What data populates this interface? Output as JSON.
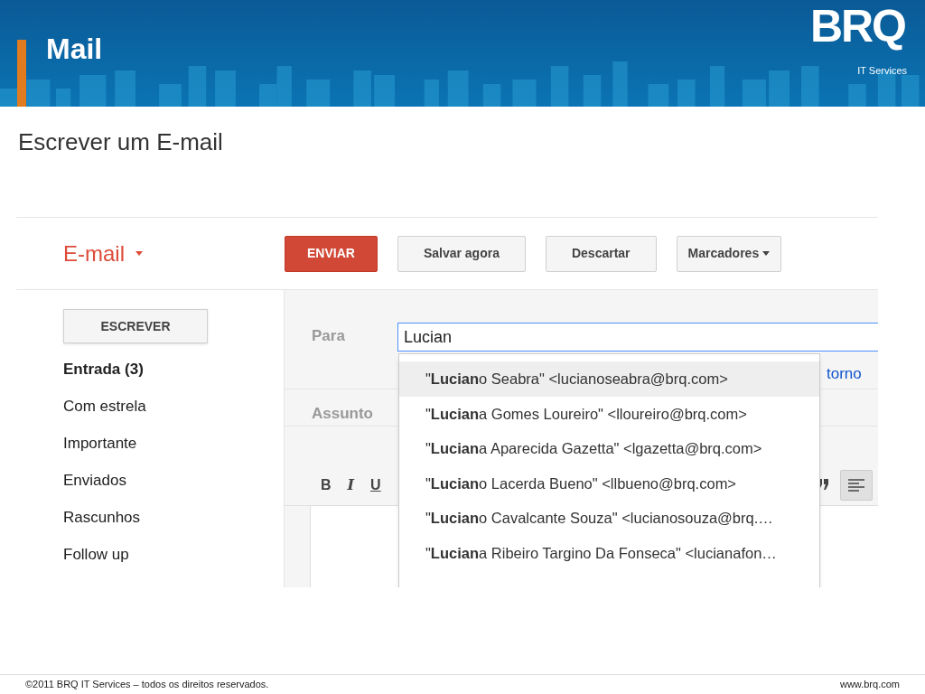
{
  "slide": {
    "title": "Mail",
    "logo": "BRQ",
    "logo_sub": "IT Services",
    "heading": "Escrever um E-mail"
  },
  "gmail": {
    "app_menu": "E-mail",
    "actions": [
      {
        "label": "ENVIAR",
        "kind": "primary"
      },
      {
        "label": "Salvar agora",
        "kind": "plain"
      },
      {
        "label": "Descartar",
        "kind": "plain"
      },
      {
        "label": "Marcadores",
        "kind": "menu"
      }
    ],
    "compose_button": "ESCREVER",
    "folders": [
      {
        "label": "Entrada (3)",
        "selected": true
      },
      {
        "label": "Com estrela",
        "selected": false
      },
      {
        "label": "Importante",
        "selected": false
      },
      {
        "label": "Enviados",
        "selected": false
      },
      {
        "label": "Rascunhos",
        "selected": false
      },
      {
        "label": "Follow up",
        "selected": false
      }
    ],
    "to_label": "Para",
    "to_value": "Lucian",
    "cc_link": "torno",
    "subject_label": "Assunto",
    "format_buttons": [
      {
        "label": "B",
        "kind": "bold"
      },
      {
        "label": "I",
        "kind": "italic"
      },
      {
        "label": "U",
        "kind": "underline"
      }
    ],
    "align_selected": true,
    "suggestions": [
      {
        "text": "\"**Lucian**o Seabra\" <lucianoseabra@brq.com>",
        "selected": true
      },
      {
        "text": "\"**Lucian**a Gomes Loureiro\" <lloureiro@brq.com>",
        "selected": false
      },
      {
        "text": "\"**Lucian**a Aparecida Gazetta\" <lgazetta@brq.com>",
        "selected": false
      },
      {
        "text": "\"**Lucian**o Lacerda Bueno\" <llbueno@brq.com>",
        "selected": false
      },
      {
        "text": "\"**Lucian**o Cavalcante Souza\" <lucianosouza@brq.…",
        "selected": false
      },
      {
        "text": "\"**Lucian**a Ribeiro Targino Da Fonseca\" <lucianafon…",
        "selected": false
      }
    ]
  },
  "footer": {
    "copyright": "©2011 BRQ IT Services – todos os direitos reservados.",
    "url": "www.brq.com"
  }
}
